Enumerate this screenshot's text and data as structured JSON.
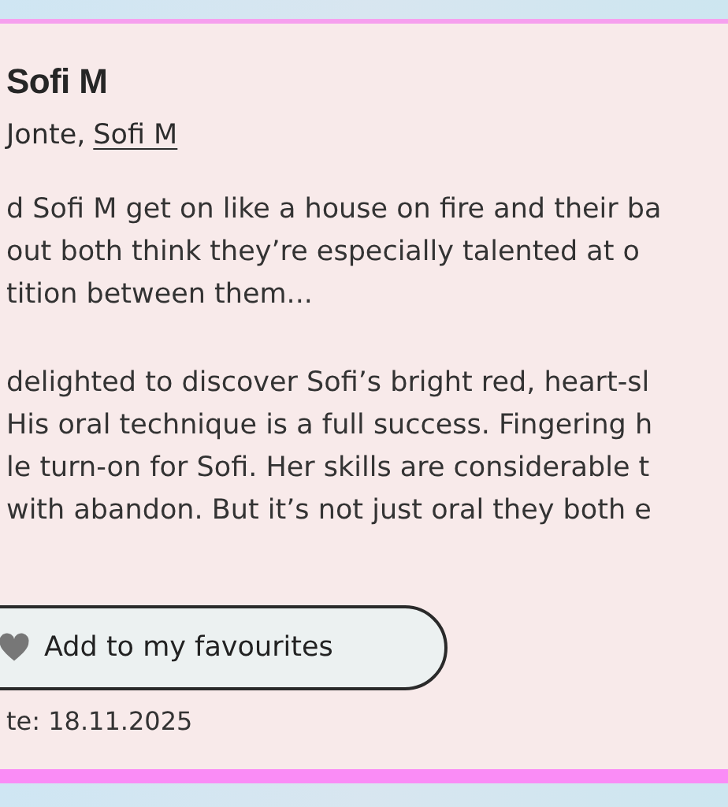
{
  "title": "Sofi M",
  "performers": {
    "prefix": "Jonte,",
    "link": "Sofi M"
  },
  "paragraphs": [
    [
      "d Sofi M get on like a house on fire and their ba",
      "out both think they’re especially talented at o",
      "tition between them..."
    ],
    [
      "delighted to discover Sofi’s bright red, heart-sl",
      "His oral technique is a full success. Fingering h",
      "le turn-on for Sofi. Her skills are considerable t",
      "with abandon. But it’s not just oral they both e"
    ]
  ],
  "favourite_button": {
    "label": "Add to my favourites"
  },
  "date": "te: 18.11.2025"
}
